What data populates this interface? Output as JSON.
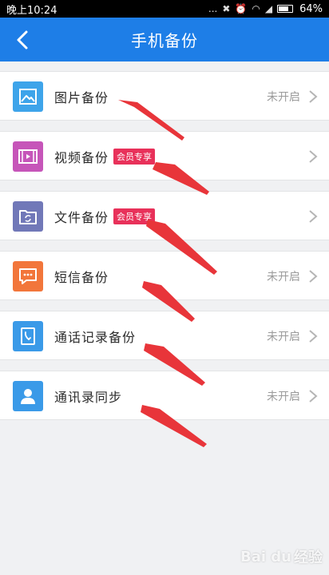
{
  "status_bar": {
    "time": "晚上10:24",
    "dots": "...",
    "battery": "64%"
  },
  "app_bar": {
    "title": "手机备份"
  },
  "items": [
    {
      "label": "图片备份",
      "status": "未开启",
      "badge": "",
      "icon": "image-icon",
      "icon_color": "#3ea4ea"
    },
    {
      "label": "视频备份",
      "status": "",
      "badge": "会员专享",
      "icon": "video-icon",
      "icon_color": "#c655b9"
    },
    {
      "label": "文件备份",
      "status": "",
      "badge": "会员专享",
      "icon": "folder-sync-icon",
      "icon_color": "#7178b8"
    },
    {
      "label": "短信备份",
      "status": "未开启",
      "badge": "",
      "icon": "message-icon",
      "icon_color": "#f2763b"
    },
    {
      "label": "通话记录备份",
      "status": "未开启",
      "badge": "",
      "icon": "phone-log-icon",
      "icon_color": "#3a9ae8"
    },
    {
      "label": "通讯录同步",
      "status": "未开启",
      "badge": "",
      "icon": "contact-icon",
      "icon_color": "#3a9ae8"
    }
  ],
  "watermark": {
    "text": "经验",
    "brand": "Bai du"
  },
  "colors": {
    "app_bar": "#1e7ee7",
    "badge": "#e8315a",
    "annotation_arrow": "#e8353a"
  }
}
